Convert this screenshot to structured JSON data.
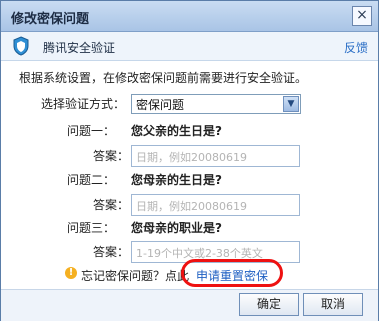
{
  "window": {
    "title": "修改密保问题"
  },
  "header": {
    "title": "腾讯安全验证",
    "feedback": "反馈"
  },
  "intro": "根据系统设置，在修改密保问题前需要进行安全验证。",
  "method": {
    "label": "选择验证方式：",
    "value": "密保问题"
  },
  "questions": [
    {
      "label": "问题一：",
      "text": "您父亲的生日是?",
      "answer_label": "答案：",
      "placeholder": "日期，例如20080619"
    },
    {
      "label": "问题二：",
      "text": "您母亲的生日是?",
      "answer_label": "答案：",
      "placeholder": "日期，例如20080619"
    },
    {
      "label": "问题三：",
      "text": "您母亲的职业是?",
      "answer_label": "答案：",
      "placeholder": "1-19个中文或2-38个英文"
    }
  ],
  "tip": {
    "text": "忘记密保问题？点此",
    "link": "申请重置密保"
  },
  "buttons": {
    "ok": "确定",
    "cancel": "取消"
  },
  "icons": {
    "close": "close-icon",
    "shield": "shield-icon",
    "dropdown": "chevron-down-icon",
    "info": "info-icon"
  }
}
